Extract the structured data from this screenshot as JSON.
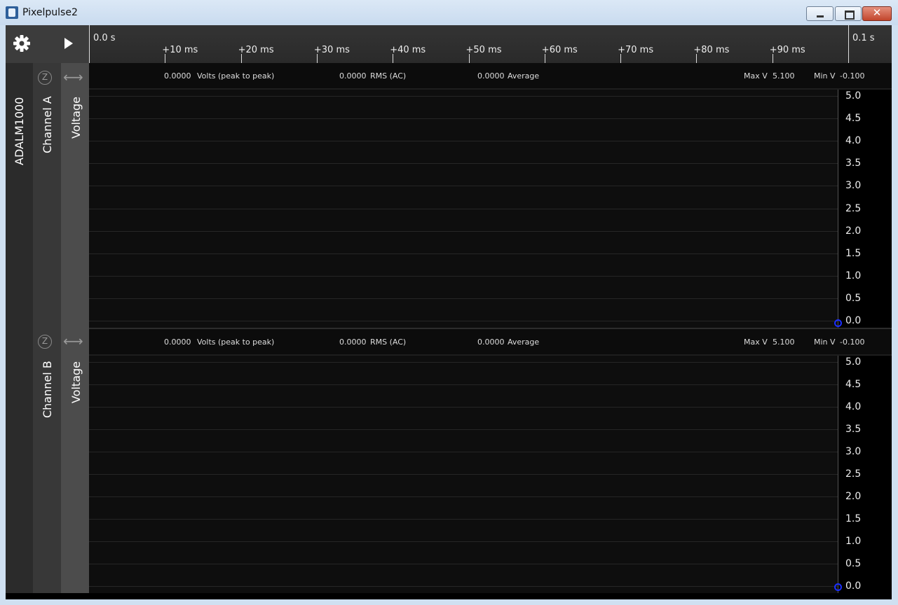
{
  "window": {
    "title": "Pixelpulse2",
    "close_glyph": "✕"
  },
  "toolbar": {
    "settings_icon": "gear-icon",
    "play_icon": "play-icon"
  },
  "time_axis": {
    "start_label": "0.0 s",
    "end_label": "0.1 s",
    "ticks": [
      "+10 ms",
      "+20 ms",
      "+30 ms",
      "+40 ms",
      "+50 ms",
      "+60 ms",
      "+70 ms",
      "+80 ms",
      "+90 ms"
    ]
  },
  "device": {
    "name": "ADALM1000"
  },
  "channels": [
    {
      "name": "Channel A",
      "signal": "Voltage",
      "zero_label": "Z",
      "stats": {
        "pp_value": "0.0000",
        "pp_label": "Volts (peak to peak)",
        "rms_value": "0.0000",
        "rms_label": "RMS (AC)",
        "avg_value": "0.0000",
        "avg_label": "Average",
        "max_label": "Max V",
        "max_value": "5.100",
        "min_label": "Min V",
        "min_value": "-0.100"
      },
      "y_ticks": [
        "5.0",
        "4.5",
        "4.0",
        "3.5",
        "3.0",
        "2.5",
        "2.0",
        "1.5",
        "1.0",
        "0.5",
        "0.0"
      ]
    },
    {
      "name": "Channel B",
      "signal": "Voltage",
      "zero_label": "Z",
      "stats": {
        "pp_value": "0.0000",
        "pp_label": "Volts (peak to peak)",
        "rms_value": "0.0000",
        "rms_label": "RMS (AC)",
        "avg_value": "0.0000",
        "avg_label": "Average",
        "max_label": "Max V",
        "max_value": "5.100",
        "min_label": "Min V",
        "min_value": "-0.100"
      },
      "y_ticks": [
        "5.0",
        "4.5",
        "4.0",
        "3.5",
        "3.0",
        "2.5",
        "2.0",
        "1.5",
        "1.0",
        "0.5",
        "0.0"
      ]
    }
  ],
  "colors": {
    "cursor": "#1b2fff",
    "background": "#000000"
  }
}
